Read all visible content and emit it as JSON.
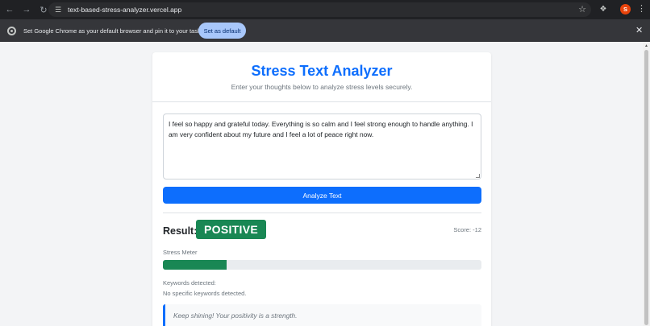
{
  "browser": {
    "url": "text-based-stress-analyzer.vercel.app",
    "profile_initial": "S",
    "infobar_text": "Set Google Chrome as your default browser and pin it to your taskbar",
    "set_default_label": "Set as default"
  },
  "app": {
    "title": "Stress Text Analyzer",
    "subtitle": "Enter your thoughts below to analyze stress levels securely.",
    "input_text": "I feel so happy and grateful today. Everything is so calm and I feel strong enough to handle anything. I am very confident about my future and I feel a lot of peace right now.",
    "analyze_label": "Analyze Text",
    "result_label": "Result:",
    "result_value": "POSITIVE",
    "score_text": "Score: -12",
    "meter_label": "Stress Meter",
    "meter_level_percent": 20,
    "keywords_label": "Keywords detected:",
    "keywords_value": "No specific keywords detected.",
    "message": "Keep shining! Your positivity is a strength."
  },
  "colors": {
    "primary": "#0d6efd",
    "positive": "#198754"
  },
  "icons": {
    "back": "arrow-left-icon",
    "forward": "arrow-right-icon",
    "reload": "reload-icon",
    "site_info": "tune-icon",
    "bookmark": "star-icon",
    "extensions": "puzzle-icon",
    "menu": "more-vert-icon",
    "close": "close-icon"
  }
}
